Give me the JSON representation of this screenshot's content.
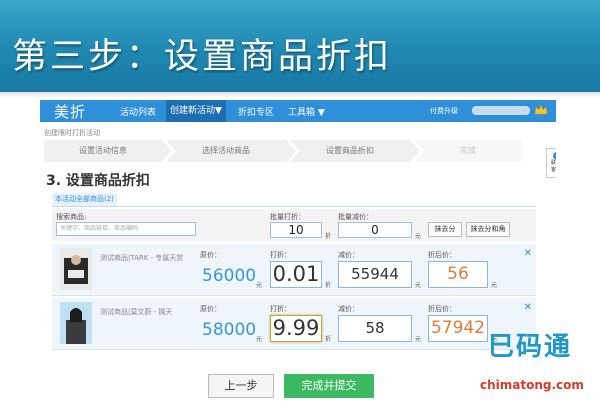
{
  "banner": {
    "title": "第三步：设置商品折扣"
  },
  "nav": {
    "logo": "美折",
    "items": [
      "活动列表",
      "创建新活动▼",
      "折扣专区",
      "工具箱 ▼"
    ],
    "upgrade": "付费升级",
    "crown_icon": "crown-icon"
  },
  "breadcrumb": "创建限时打折活动",
  "steps": [
    "设置活动信息",
    "选择活动商品",
    "设置商品折扣",
    "完成"
  ],
  "contact": {
    "label1": "联系",
    "label2": "客服"
  },
  "section_title": "3. 设置商品折扣",
  "tab_all": "本活动全部商品(2)",
  "filter": {
    "search_label": "搜索商品:",
    "search_placeholder": "关键字、商品链接、商品编码",
    "batch_discount_label": "批量打折：",
    "batch_discount_value": "10",
    "discount_unit": "折",
    "batch_reduce_label": "批量减价：",
    "batch_reduce_value": "0",
    "yuan_unit": "元",
    "btn_round_fen": "抹去分",
    "btn_round_jiao": "抹去分和角"
  },
  "labels": {
    "original_price": "原价：",
    "discount": "打折：",
    "reduce": "减价：",
    "final_price": "折后价：",
    "yuan": "元",
    "zhe": "折"
  },
  "products": [
    {
      "name": "测试商品|TARK - 专属天赏",
      "price": "56000",
      "discount": "0.01",
      "reduce": "55944",
      "final": "56"
    },
    {
      "name": "测试商品|莫文蔚 - 拥天",
      "price": "58000",
      "discount": "9.99",
      "reduce": "58",
      "final": "57942"
    }
  ],
  "actions": {
    "prev": "上一步",
    "submit": "完成并提交"
  },
  "watermark": {
    "cn": "巳码通",
    "url": "chimatong.com"
  }
}
